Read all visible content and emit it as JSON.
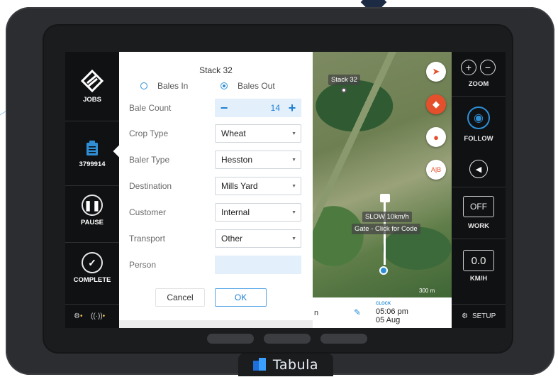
{
  "brand": {
    "name": "Tabula"
  },
  "left_bar": {
    "jobs_label": "JOBS",
    "job_id": "3799914",
    "pause_label": "PAUSE",
    "complete_label": "COMPLETE"
  },
  "dialog": {
    "title": "Stack 32",
    "radio_in": "Bales In",
    "radio_out": "Bales Out",
    "selected_radio": "Bales Out",
    "fields": {
      "bale_count_label": "Bale Count",
      "bale_count_value": "14",
      "crop_type_label": "Crop Type",
      "crop_type_value": "Wheat",
      "baler_type_label": "Baler Type",
      "baler_type_value": "Hesston",
      "destination_label": "Destination",
      "destination_value": "Mills Yard",
      "customer_label": "Customer",
      "customer_value": "Internal",
      "transport_label": "Transport",
      "transport_value": "Other",
      "person_label": "Person",
      "person_value": ""
    },
    "cancel_label": "Cancel",
    "ok_label": "OK"
  },
  "map": {
    "stack_label": "Stack 32",
    "speed_label": "SLOW 10km/h",
    "gate_label": "Gate - Click for Code",
    "scale_label": "300 m",
    "ab_label": "A|B"
  },
  "info": {
    "clock_title": "CLOCK",
    "time": "05:06 pm",
    "date": "05 Aug",
    "fragment": "n"
  },
  "right_bar": {
    "zoom_label": "ZOOM",
    "follow_label": "FOLLOW",
    "work_value": "OFF",
    "work_label": "WORK",
    "speed_value": "0.0",
    "speed_label": "KM/H",
    "setup_label": "SETUP"
  },
  "colors": {
    "accent": "#2e8fd6",
    "warning": "#e4502b",
    "screen_bg": "#101113"
  }
}
